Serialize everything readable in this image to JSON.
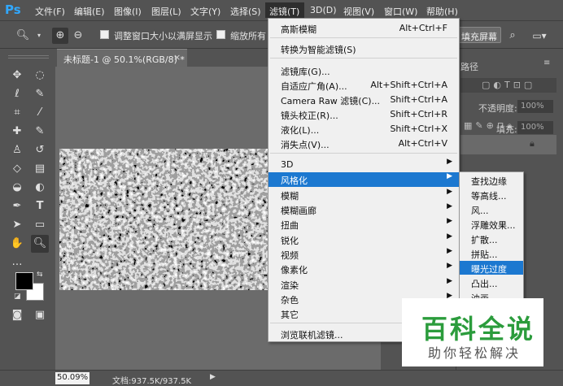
{
  "app": {
    "logo": "Ps"
  },
  "menubar": {
    "items": [
      "文件(F)",
      "编辑(E)",
      "图像(I)",
      "图层(L)",
      "文字(Y)",
      "选择(S)",
      "滤镜(T)",
      "3D(D)",
      "视图(V)",
      "窗口(W)",
      "帮助(H)"
    ],
    "active_index": 6
  },
  "options": {
    "resize_windows_label": "调整窗口大小以满屏显示",
    "zoom_all_label": "缩放所有",
    "fill_screen_label": "填充屏幕"
  },
  "document": {
    "tab_title": "未标题-1 @ 50.1%(RGB/8) *",
    "close_glyph": "×"
  },
  "statusbar": {
    "zoom": "50.09%",
    "doc_size": "文档:937.5K/937.5K"
  },
  "panel": {
    "tab_partial": "路径",
    "opacity_label": "不透明度:",
    "opacity_value": "100%",
    "fill_label": "填充:",
    "fill_value": "100%"
  },
  "filter_menu": {
    "items": [
      {
        "label": "高斯模糊",
        "shortcut": "Alt+Ctrl+F"
      },
      {
        "label": "转换为智能滤镜(S)",
        "shortcut": ""
      },
      {
        "label": "滤镜库(G)...",
        "shortcut": ""
      },
      {
        "label": "自适应广角(A)...",
        "shortcut": "Alt+Shift+Ctrl+A"
      },
      {
        "label": "Camera Raw 滤镜(C)...",
        "shortcut": "Shift+Ctrl+A"
      },
      {
        "label": "镜头校正(R)...",
        "shortcut": "Shift+Ctrl+R"
      },
      {
        "label": "液化(L)...",
        "shortcut": "Shift+Ctrl+X"
      },
      {
        "label": "消失点(V)...",
        "shortcut": "Alt+Ctrl+V"
      },
      {
        "label": "3D",
        "shortcut": ""
      },
      {
        "label": "风格化",
        "shortcut": ""
      },
      {
        "label": "模糊",
        "shortcut": ""
      },
      {
        "label": "模糊画廊",
        "shortcut": ""
      },
      {
        "label": "扭曲",
        "shortcut": ""
      },
      {
        "label": "锐化",
        "shortcut": ""
      },
      {
        "label": "视频",
        "shortcut": ""
      },
      {
        "label": "像素化",
        "shortcut": ""
      },
      {
        "label": "渲染",
        "shortcut": ""
      },
      {
        "label": "杂色",
        "shortcut": ""
      },
      {
        "label": "其它",
        "shortcut": ""
      },
      {
        "label": "浏览联机滤镜...",
        "shortcut": ""
      }
    ],
    "highlighted": "风格化"
  },
  "stylize_submenu": {
    "items": [
      "查找边缘",
      "等高线...",
      "风...",
      "浮雕效果...",
      "扩散...",
      "拼贴...",
      "曝光过度",
      "凸出...",
      "油画..."
    ],
    "highlighted": "曝光过度"
  },
  "watermark": {
    "title": "百科全说",
    "subtitle": "助你轻松解决"
  },
  "colors": {
    "accent": "#1c78d0",
    "watermark_green": "#2b9c3c",
    "ps_blue": "#31a8ff"
  }
}
